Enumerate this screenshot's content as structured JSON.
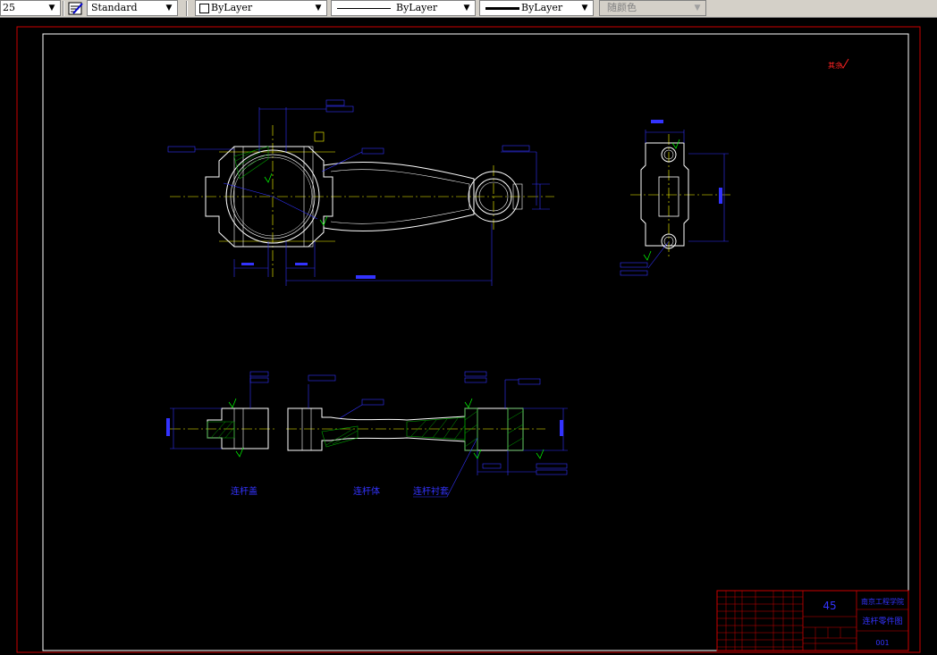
{
  "toolbar": {
    "scale_value": "25",
    "text_style": "Standard",
    "layer": "ByLayer",
    "linetype": "ByLayer",
    "lineweight": "ByLayer",
    "plot_style": "随颜色",
    "arrow": "▼"
  },
  "drawing": {
    "section_labels": [
      "连杆盖",
      "连杆体",
      "连杆衬套"
    ],
    "title_block": {
      "material": "45",
      "school": "南京工程学院",
      "drawing_name": "连杆零件图",
      "drawing_number": "001"
    },
    "annotation_red": "其余"
  },
  "colors": {
    "canvas_bg": "#000000",
    "border": "#ffffff",
    "outer_border": "#cc0000",
    "dimension": "#3333ff",
    "centerline": "#ffff00",
    "hatch": "#00aa00",
    "title_block": "#cc0000"
  }
}
